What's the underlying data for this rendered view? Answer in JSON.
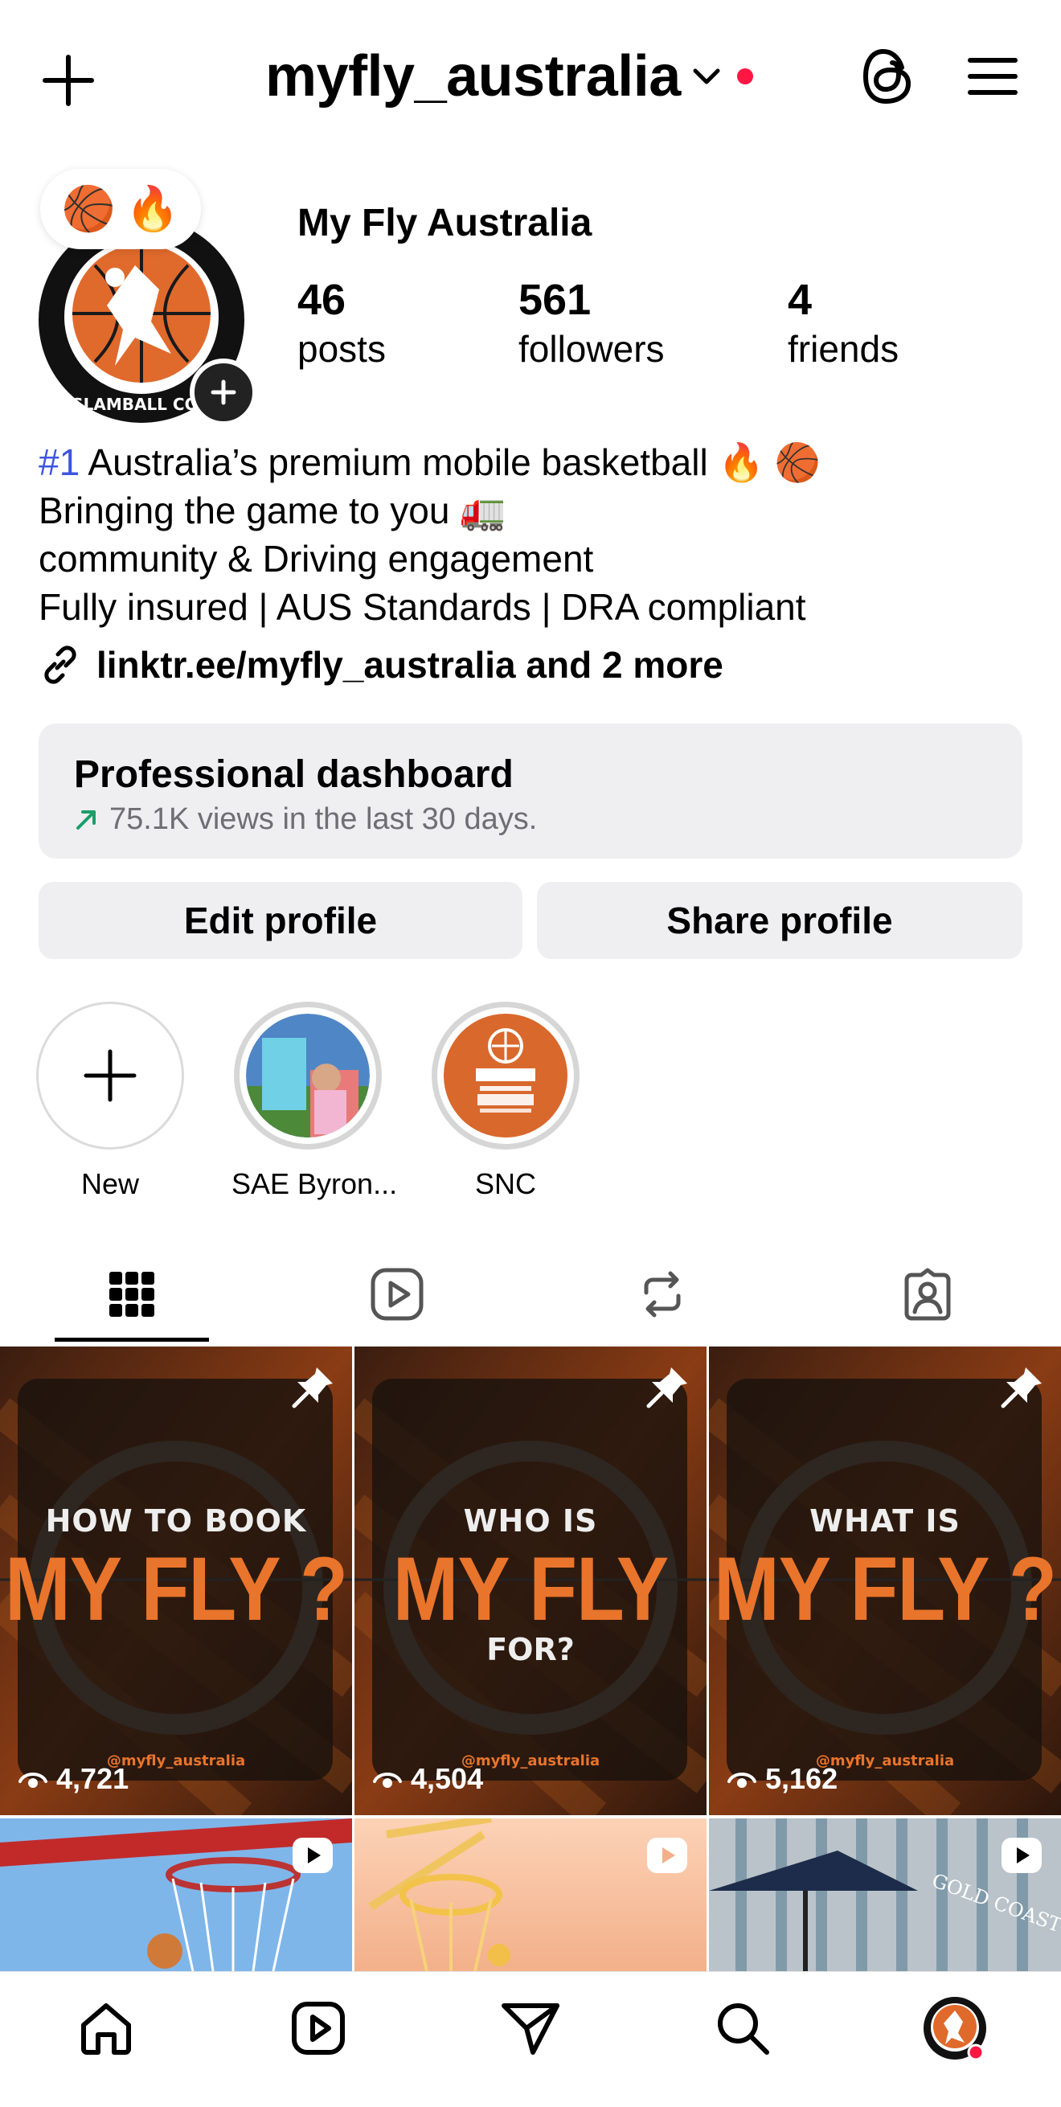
{
  "header": {
    "username": "myfly_australia",
    "icons": [
      "plus-icon",
      "chevron-down-icon",
      "threads-icon",
      "hamburger-menu-icon"
    ]
  },
  "profile": {
    "note_emojis": [
      "🏀",
      "🔥"
    ],
    "display_name": "My Fly Australia",
    "stats": {
      "posts": {
        "value": "46",
        "label": "posts"
      },
      "followers": {
        "value": "561",
        "label": "followers"
      },
      "friends": {
        "value": "4",
        "label": "friends"
      }
    },
    "bio": {
      "hashtag": "#1",
      "line1_rest": " Australia’s premium mobile basketball 🔥 🏀",
      "line2": "Bringing the game to you 🚛",
      "line3": "community & Driving engagement",
      "line4": "Fully insured | AUS Standards | DRA compliant"
    },
    "link": "linktr.ee/myfly_australia and 2 more"
  },
  "dashboard": {
    "title": "Professional dashboard",
    "subtitle": "75.1K views in the last 30 days.",
    "accent": "#1c9d6a"
  },
  "actions": {
    "edit": "Edit profile",
    "share": "Share profile"
  },
  "highlights": [
    {
      "label": "New"
    },
    {
      "label": "SAE Byron..."
    },
    {
      "label": "SNC"
    }
  ],
  "tabs": [
    "grid-icon",
    "reels-icon",
    "reposts-icon",
    "tagged-icon"
  ],
  "posts": [
    {
      "top": "HOW TO BOOK",
      "main": "MY FLY ?",
      "sub": "",
      "handle": "@myfly_australia",
      "views": "4,721",
      "pinned": true
    },
    {
      "top": "WHO IS",
      "main": "MY FLY",
      "sub": "FOR?",
      "handle": "@myfly_australia",
      "views": "4,504",
      "pinned": true
    },
    {
      "top": "WHAT IS",
      "main": "MY FLY ?",
      "sub": "",
      "handle": "@myfly_australia",
      "views": "5,162",
      "pinned": true
    }
  ],
  "bottom_posts": [
    {
      "type": "reel",
      "caption": ""
    },
    {
      "type": "reel",
      "caption": ""
    },
    {
      "type": "reel",
      "caption": "GOLD COAST SPORTS"
    }
  ],
  "bottom_nav": [
    "home-icon",
    "reels-icon",
    "messages-icon",
    "search-icon",
    "profile-avatar"
  ],
  "colors": {
    "accent_orange": "#e9742b",
    "hashtag_blue": "#3d55e0",
    "notification_red": "#ff1744"
  }
}
